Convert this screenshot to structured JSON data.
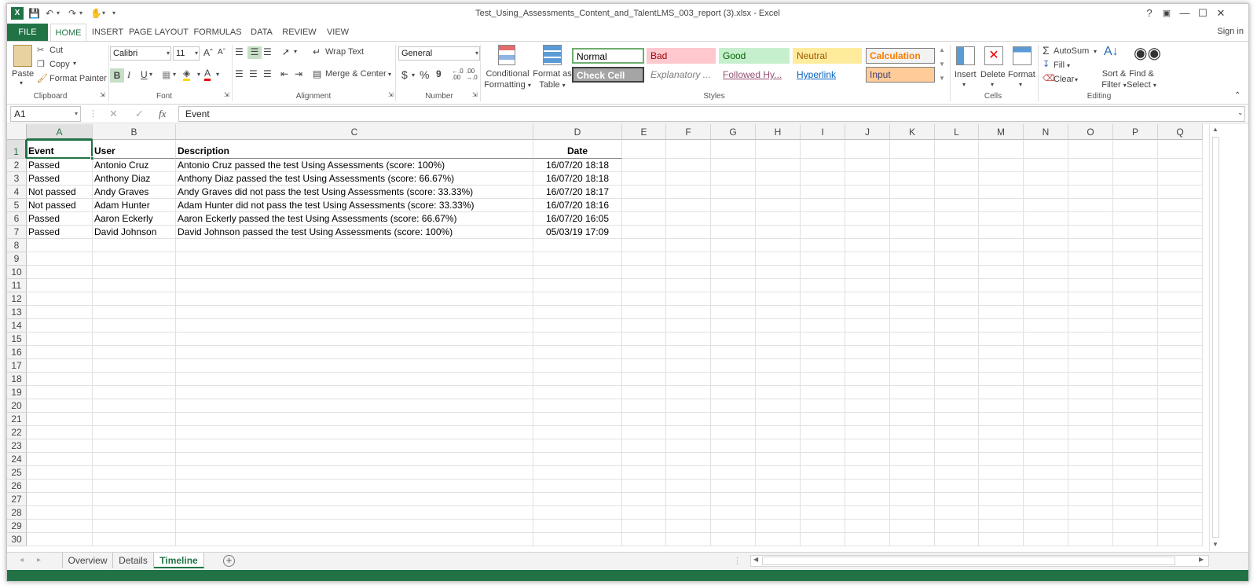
{
  "window": {
    "title": "Test_Using_Assessments_Content_and_TalentLMS_003_report (3).xlsx - Excel",
    "sign_in": "Sign in",
    "help": "?",
    "minimize": "—",
    "restore": "☐",
    "close": "✕"
  },
  "tabs": {
    "file": "FILE",
    "home": "HOME",
    "insert": "INSERT",
    "page_layout": "PAGE LAYOUT",
    "formulas": "FORMULAS",
    "data": "DATA",
    "review": "REVIEW",
    "view": "VIEW"
  },
  "ribbon": {
    "clipboard": {
      "paste": "Paste",
      "cut": "Cut",
      "copy": "Copy",
      "format_painter": "Format Painter",
      "label": "Clipboard"
    },
    "font": {
      "name": "Calibri",
      "size": "11",
      "bold": "B",
      "italic": "I",
      "underline": "U",
      "label": "Font"
    },
    "alignment": {
      "wrap_text": "Wrap Text",
      "merge_center": "Merge & Center",
      "label": "Alignment"
    },
    "number": {
      "format": "General",
      "currency": "$",
      "percent": "%",
      "comma": "9",
      "label": "Number"
    },
    "styles": {
      "conditional_formatting_1": "Conditional",
      "conditional_formatting_2": "Formatting",
      "format_as_table_1": "Format as",
      "format_as_table_2": "Table",
      "normal": "Normal",
      "bad": "Bad",
      "good": "Good",
      "neutral": "Neutral",
      "calculation": "Calculation",
      "check_cell": "Check Cell",
      "explanatory": "Explanatory ...",
      "followed_hyperlink": "Followed Hy...",
      "hyperlink": "Hyperlink",
      "input": "Input",
      "label": "Styles"
    },
    "cells": {
      "insert": "Insert",
      "delete": "Delete",
      "format": "Format",
      "label": "Cells"
    },
    "editing": {
      "autosum": "AutoSum",
      "fill": "Fill",
      "clear": "Clear",
      "sort_filter_1": "Sort &",
      "sort_filter_2": "Filter",
      "find_select_1": "Find &",
      "find_select_2": "Select",
      "label": "Editing"
    }
  },
  "formula_bar": {
    "name_box": "A1",
    "fx": "fx",
    "value": "Event"
  },
  "columns": [
    "A",
    "B",
    "C",
    "D",
    "E",
    "F",
    "G",
    "H",
    "I",
    "J",
    "K",
    "L",
    "M",
    "N",
    "O",
    "P",
    "Q"
  ],
  "header_row": [
    "Event",
    "User",
    "Description",
    "Date"
  ],
  "rows": [
    [
      "Passed",
      "Antonio Cruz",
      "Antonio Cruz passed the test Using Assessments (score: 100%)",
      "16/07/20 18:18"
    ],
    [
      "Passed",
      "Anthony Diaz",
      "Anthony Diaz passed the test Using Assessments (score: 66.67%)",
      "16/07/20 18:18"
    ],
    [
      "Not passed",
      "Andy Graves",
      "Andy Graves did not pass the test Using Assessments (score: 33.33%)",
      "16/07/20 18:17"
    ],
    [
      "Not passed",
      "Adam Hunter",
      "Adam Hunter did not pass the test Using Assessments (score: 33.33%)",
      "16/07/20 18:16"
    ],
    [
      "Passed",
      "Aaron Eckerly",
      "Aaron Eckerly passed the test Using Assessments (score: 66.67%)",
      "16/07/20 16:05"
    ],
    [
      "Passed",
      "David Johnson",
      "David Johnson passed the test Using Assessments (score: 100%)",
      "05/03/19 17:09"
    ]
  ],
  "row_count": 30,
  "sheets": [
    "Overview",
    "Details",
    "Timeline"
  ],
  "active_sheet": "Timeline",
  "colors": {
    "accent": "#217346"
  }
}
